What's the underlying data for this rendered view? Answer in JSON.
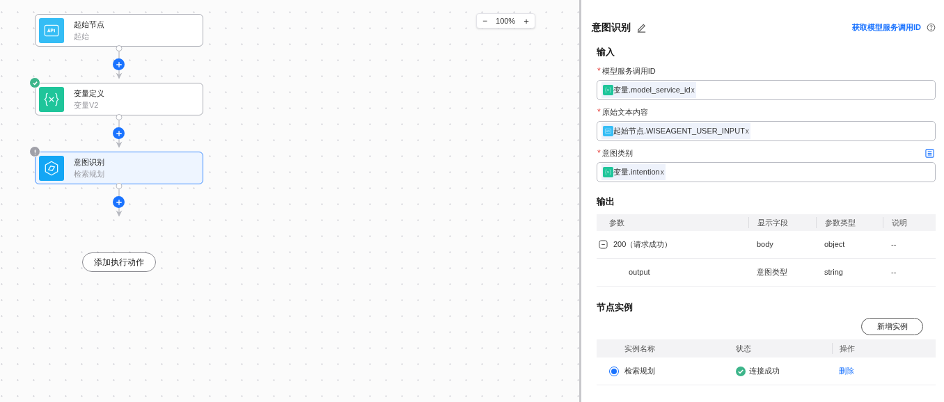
{
  "canvas": {
    "nodes": [
      {
        "title": "起始节点",
        "subtitle": "起始",
        "kind": "api",
        "passed": false,
        "warning": false,
        "selected": false
      },
      {
        "title": "变量定义",
        "subtitle": "变量V2",
        "kind": "variable",
        "passed": true,
        "warning": false,
        "selected": false
      },
      {
        "title": "意图识别",
        "subtitle": "检索规划",
        "kind": "intent",
        "passed": false,
        "warning": true,
        "selected": true
      }
    ],
    "add_action_button": "添加执行动作",
    "zoom": {
      "minus": "−",
      "value": "100%",
      "plus": "+"
    }
  },
  "panel": {
    "title": "意图识别",
    "link": "获取模型服务调用ID",
    "input_heading": "输入",
    "inputs": [
      {
        "required_mark": "*",
        "label": "模型服务调用ID",
        "list_button": false,
        "tag": {
          "kind": "variable",
          "text": "变量.model_service_id",
          "remove": "x"
        }
      },
      {
        "required_mark": "*",
        "label": "原始文本内容",
        "list_button": false,
        "tag": {
          "kind": "api",
          "text": "起始节点.WISEAGENT_USER_INPUT",
          "remove": "x"
        }
      },
      {
        "required_mark": "*",
        "label": "意图类别",
        "list_button": true,
        "tag": {
          "kind": "variable",
          "text": "变量.intention",
          "remove": "x"
        }
      }
    ],
    "output_heading": "输出",
    "output_table": {
      "columns": [
        "参数",
        "显示字段",
        "参数类型",
        "说明"
      ],
      "rows": [
        {
          "cells": [
            "200（请求成功）",
            "body",
            "object",
            "--"
          ],
          "expanded": true,
          "children": [
            {
              "cells": [
                "output",
                "意图类型",
                "string",
                "--"
              ]
            }
          ]
        }
      ]
    },
    "instances_heading": "节点实例",
    "add_instance_button": "新增实例",
    "instances_table": {
      "columns": [
        "实例名称",
        "状态",
        "操作"
      ],
      "rows": [
        {
          "name": "检索规划",
          "selected": true,
          "status": "连接成功",
          "connected": true,
          "action": "删除"
        }
      ]
    }
  }
}
